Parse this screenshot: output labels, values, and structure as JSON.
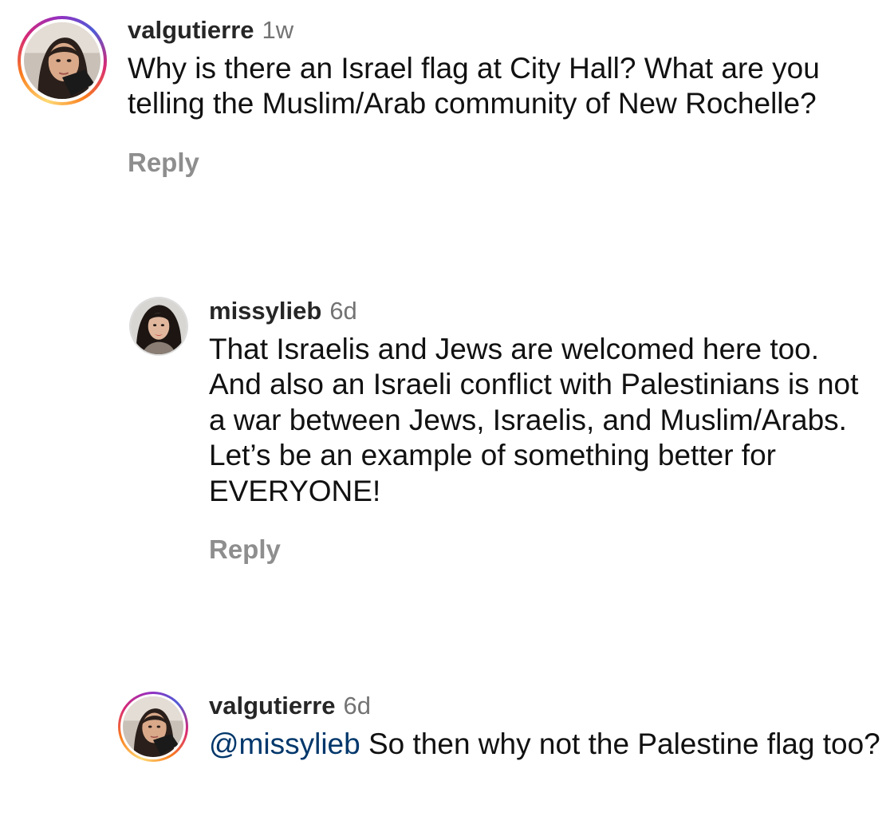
{
  "comments": [
    {
      "username": "valgutierre",
      "time": "1w",
      "text": "Why is there an Israel flag at City Hall? What are you telling the Muslim/Arab community of New Rochelle?",
      "reply_label": "Reply",
      "avatar": "profile-photo",
      "has_story_ring": true
    },
    {
      "username": "missylieb",
      "time": "6d",
      "text": "That Israelis and Jews are welcomed here too. And also an Israeli conflict with Palestinians is not a war between Jews, Israelis, and Muslim/Arabs. Let’s be an example of something better for EVERYONE!",
      "reply_label": "Reply",
      "avatar": "profile-photo",
      "has_story_ring": false
    },
    {
      "username": "valgutierre",
      "time": "6d",
      "mention": "@missylieb",
      "text": " So then why not the Palestine flag too?",
      "avatar": "profile-photo",
      "has_story_ring": true
    }
  ],
  "colors": {
    "text": "#111111",
    "username": "#262626",
    "meta": "#737373",
    "reply": "#8e8e8e",
    "mention": "#00376b"
  }
}
